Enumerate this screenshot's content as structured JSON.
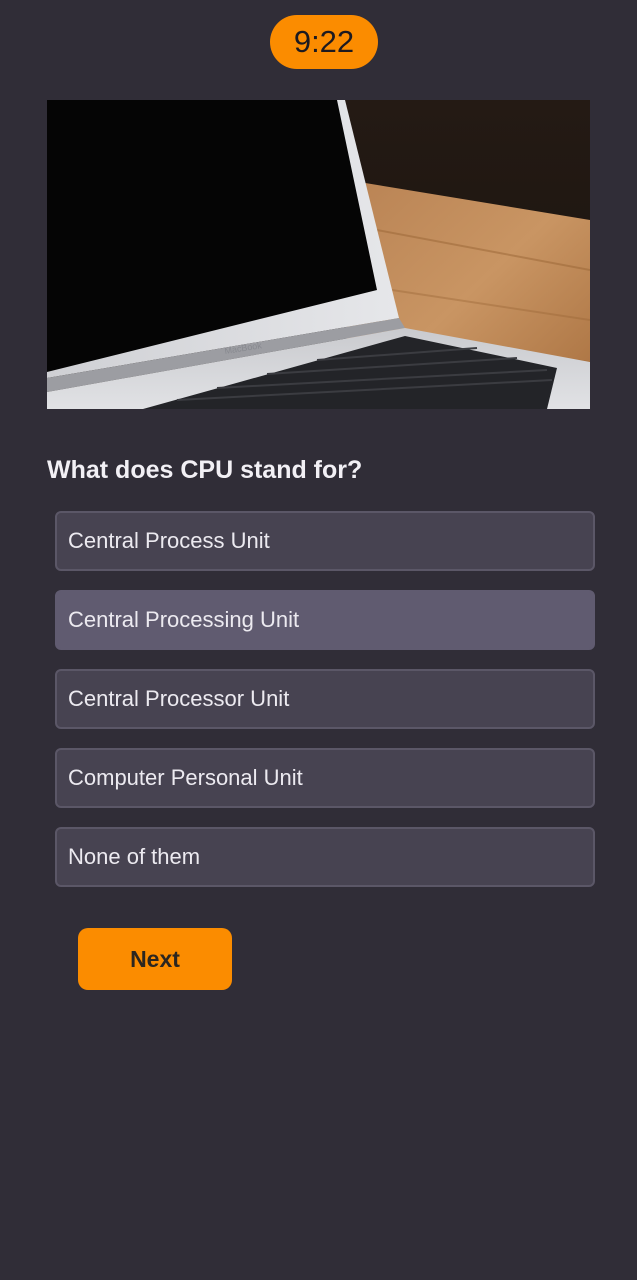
{
  "timer": {
    "text": "9:22"
  },
  "quiz": {
    "question": "What does CPU stand for?",
    "options": [
      {
        "label": "Central Process Unit",
        "selected": false
      },
      {
        "label": "Central Processing Unit",
        "selected": true
      },
      {
        "label": "Central Processor Unit",
        "selected": false
      },
      {
        "label": "Computer Personal Unit",
        "selected": false
      },
      {
        "label": "None of them",
        "selected": false
      }
    ],
    "next_label": "Next"
  },
  "colors": {
    "background": "#302d37",
    "accent": "#fb8c00",
    "option_bg": "#474351",
    "option_selected_bg": "#605b70"
  }
}
